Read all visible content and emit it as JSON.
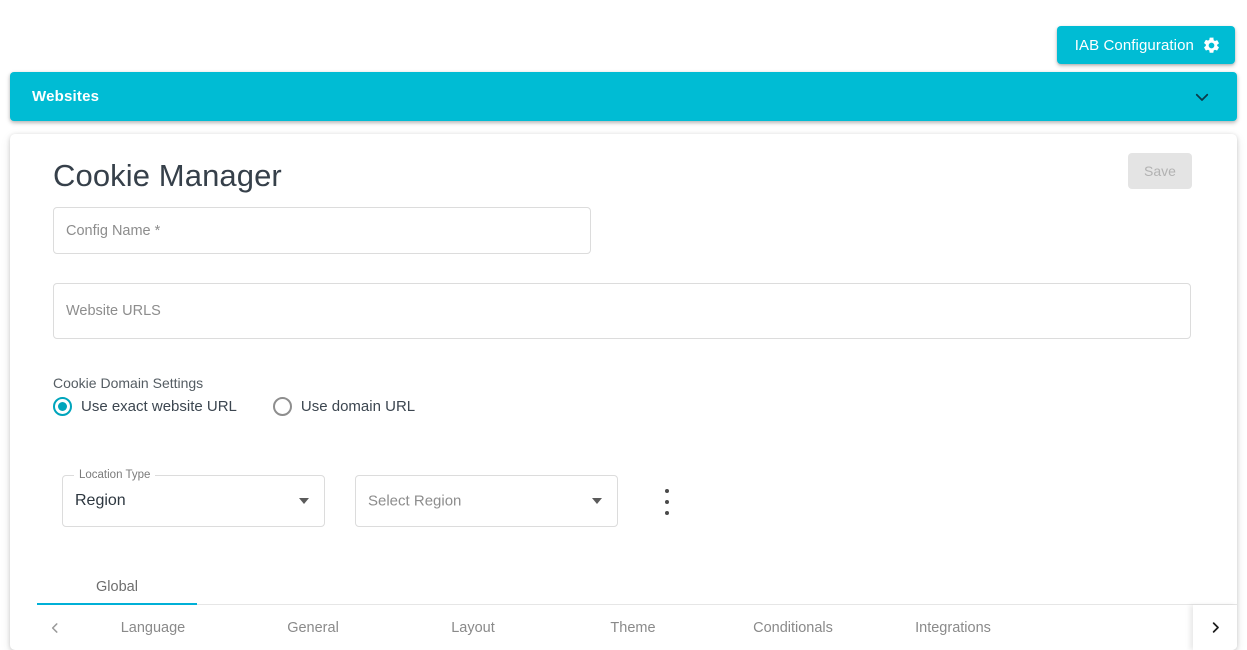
{
  "topbar": {
    "iab_button_label": "IAB Configuration",
    "iab_icon": "gear-icon",
    "accent_color": "#00bcd4"
  },
  "accordion": {
    "title": "Websites",
    "chevron_icon": "chevron-down-icon",
    "background_color": "#00bcd4"
  },
  "card": {
    "title": "Cookie Manager",
    "save_label": "Save",
    "save_disabled": true,
    "fields": {
      "config_name": {
        "value": "",
        "placeholder": "Config Name *"
      },
      "website_urls": {
        "value": "",
        "placeholder": "Website URLS"
      }
    },
    "domain_settings": {
      "label": "Cookie Domain Settings",
      "options": [
        {
          "label": "Use exact website URL",
          "selected": true
        },
        {
          "label": "Use domain URL",
          "selected": false
        }
      ],
      "selected_color": "#00a5bc"
    },
    "location": {
      "location_type": {
        "floating_label": "Location Type",
        "value": "Region",
        "arrow_icon": "chevron-down-icon"
      },
      "region": {
        "placeholder": "Select Region",
        "value": "",
        "arrow_icon": "chevron-down-icon"
      },
      "overflow_icon": "kebab-menu-icon"
    },
    "tabs_primary": [
      {
        "label": "Global",
        "active": true
      }
    ],
    "tabs_primary_indicator_color": "#00b0d7",
    "tabs_secondary": {
      "scroll_left_icon": "chevron-left-icon",
      "scroll_right_icon": "chevron-right-icon",
      "items": [
        {
          "label": "Language",
          "active": false
        },
        {
          "label": "General",
          "active": false
        },
        {
          "label": "Layout",
          "active": false
        },
        {
          "label": "Theme",
          "active": false
        },
        {
          "label": "Conditionals",
          "active": false
        },
        {
          "label": "Integrations",
          "active": false
        }
      ]
    }
  }
}
